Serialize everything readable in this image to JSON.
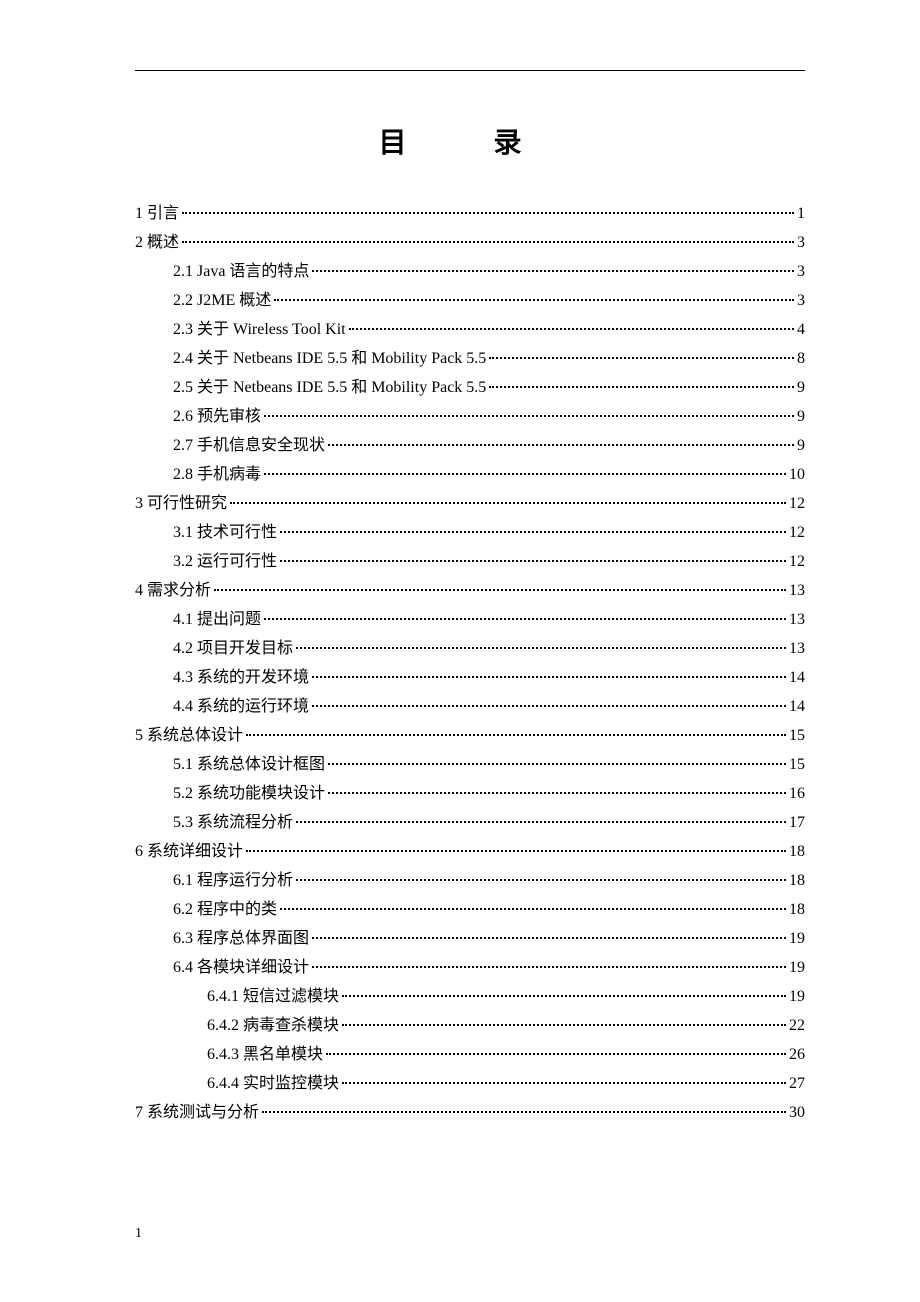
{
  "title": "目  录",
  "footer": "1",
  "entries": [
    {
      "level": 0,
      "label": "1  引言",
      "page": "1"
    },
    {
      "level": 0,
      "label": "2  概述",
      "page": "3"
    },
    {
      "level": 1,
      "label": "2.1 Java 语言的特点",
      "page": "3"
    },
    {
      "level": 1,
      "label": "2.2 J2ME 概述",
      "page": "3"
    },
    {
      "level": 1,
      "label": "2.3 关于 Wireless Tool Kit",
      "page": "4"
    },
    {
      "level": 1,
      "label": "2.4 关于 Netbeans IDE 5.5 和 Mobility Pack 5.5",
      "page": "8"
    },
    {
      "level": 1,
      "label": "2.5 关于 Netbeans IDE 5.5 和 Mobility Pack 5.5",
      "page": "9"
    },
    {
      "level": 1,
      "label": "2.6 预先审核",
      "page": "9"
    },
    {
      "level": 1,
      "label": "2.7  手机信息安全现状",
      "page": "9"
    },
    {
      "level": 1,
      "label": "2.8  手机病毒",
      "page": "10"
    },
    {
      "level": 0,
      "label": "3  可行性研究",
      "page": "12"
    },
    {
      "level": 1,
      "label": "3.1  技术可行性",
      "page": "12"
    },
    {
      "level": 1,
      "label": "3.2  运行可行性",
      "page": "12"
    },
    {
      "level": 0,
      "label": "4  需求分析",
      "page": "13"
    },
    {
      "level": 1,
      "label": "4.1  提出问题",
      "page": "13"
    },
    {
      "level": 1,
      "label": "4.2  项目开发目标",
      "page": "13"
    },
    {
      "level": 1,
      "label": "4.3  系统的开发环境",
      "page": "14"
    },
    {
      "level": 1,
      "label": "4.4  系统的运行环境",
      "page": "14"
    },
    {
      "level": 0,
      "label": "5  系统总体设计",
      "page": "15"
    },
    {
      "level": 1,
      "label": "5.1  系统总体设计框图",
      "page": "15"
    },
    {
      "level": 1,
      "label": "5.2  系统功能模块设计",
      "page": "16"
    },
    {
      "level": 1,
      "label": "5.3  系统流程分析",
      "page": "17"
    },
    {
      "level": 0,
      "label": "6  系统详细设计",
      "page": "18"
    },
    {
      "level": 1,
      "label": "6.1  程序运行分析",
      "page": "18"
    },
    {
      "level": 1,
      "label": "6.2  程序中的类",
      "page": "18"
    },
    {
      "level": 1,
      "label": "6.3  程序总体界面图",
      "page": "19"
    },
    {
      "level": 1,
      "label": "6.4  各模块详细设计",
      "page": "19"
    },
    {
      "level": 2,
      "label": "6.4.1 短信过滤模块",
      "page": "19"
    },
    {
      "level": 2,
      "label": "6.4.2 病毒查杀模块",
      "page": "22"
    },
    {
      "level": 2,
      "label": "6.4.3 黑名单模块",
      "page": "26"
    },
    {
      "level": 2,
      "label": "6.4.4 实时监控模块",
      "page": "27"
    },
    {
      "level": 0,
      "label": "7  系统测试与分析",
      "page": "30"
    }
  ]
}
